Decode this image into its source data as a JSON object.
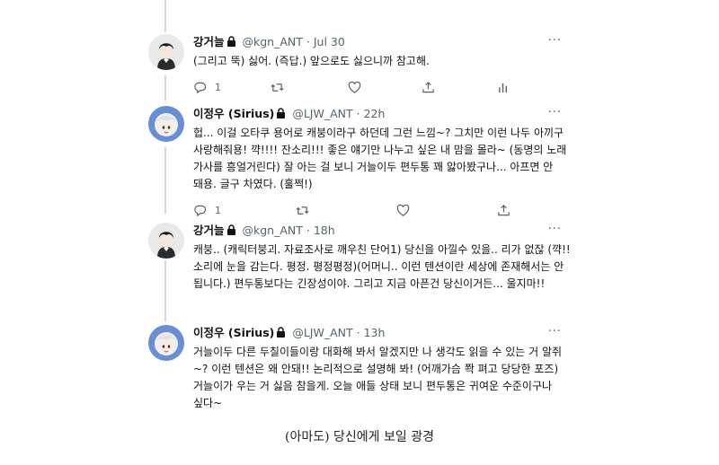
{
  "tweets": [
    {
      "name": "강거늘",
      "handle": "@kgn_ANT",
      "sep": "·",
      "time": "Jul 30",
      "more": "···",
      "text": "(그리고 뚝) 싫어. (즉답.) 앞으로도 싫으니까 참고해.",
      "reply_count": "1"
    },
    {
      "name": "이정우 (Sirius)",
      "handle": "@LJW_ANT",
      "sep": "·",
      "time": "22h",
      "more": "···",
      "text": "헙... 이걸 오타쿠 용어로 캐붕이라구 하던데 그런 느낌~? 그치만 이런 나두 아끼구 사랑해줘용! 꺅!!!! 잔소리!!! 좋은 얘기만 나누고 싶은 내 맘을 몰라~ (동명의 노래 가사를 흥얼거린다) 잘 아는 걸 보니 거늘이두 편두통 꽤 앓아봤구나... 아프면 안 돼용. 글구 차였다. (훌쩍!)",
      "reply_count": "1"
    },
    {
      "name": "강거늘",
      "handle": "@kgn_ANT",
      "sep": "·",
      "time": "18h",
      "more": "···",
      "text": "캐붕.. (캐릭터붕괴. 자료조사로 깨우친 단어1) 당신을 아낄수 있을.. 리가 없잖 (꺅!! 소리에 눈을 감는다. 평정. 평정평정)(어머니.. 이런 텐션이란 세상에 존재해서는 안 됩니다.) 편두통보다는 긴장성이야. 그리고 지금 아픈건 당신이거든... 울지마!!",
      "reply_count": ""
    },
    {
      "name": "이정우 (Sirius)",
      "handle": "@LJW_ANT",
      "sep": "·",
      "time": "13h",
      "more": "···",
      "text": "거늘이두 다른 두칠이들이랑 대화해 봐서 알겠지만 나 생각도 읽을 수 있는 거 알쥐~? 이런 텐션은 왜 안돼!! 논리적으로 설명해 봐! (어깨가슴 쫙 펴고 당당한 포즈) 거늘이가 우는 거 싫음 참을게. 오늘 애들 상태 보니 편두통은 귀여운 수준이구나 싶다~",
      "reply_count": ""
    }
  ],
  "caption": "(아마도) 당신에게 보일 광경",
  "colors": {
    "muted": "#536471",
    "thread_line": "#cfd9de",
    "text": "#0f1419"
  },
  "icons": [
    "lock-icon",
    "reply-icon",
    "retweet-icon",
    "like-icon",
    "share-icon",
    "analytics-icon",
    "more-icon"
  ]
}
